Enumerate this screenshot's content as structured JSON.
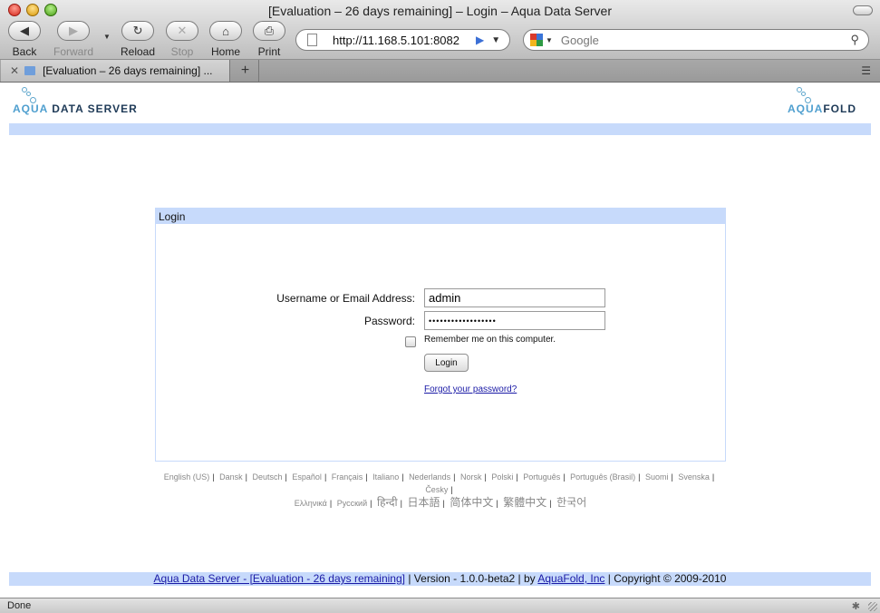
{
  "window": {
    "title": "[Evaluation – 26 days remaining] – Login – Aqua Data Server"
  },
  "toolbar": {
    "back": "Back",
    "forward": "Forward",
    "reload": "Reload",
    "stop": "Stop",
    "home": "Home",
    "print": "Print"
  },
  "address": {
    "url": "http://11.168.5.101:8082"
  },
  "search": {
    "placeholder": "Google"
  },
  "tabs": [
    {
      "title": "[Evaluation – 26 days remaining] ..."
    }
  ],
  "logos": {
    "left_aqua": "AQUA",
    "left_rest": "DATA SERVER",
    "right_aqua": "AQUA",
    "right_rest": "FOLD"
  },
  "login": {
    "header": "Login",
    "username_label": "Username or Email Address:",
    "username_value": "admin",
    "password_label": "Password:",
    "password_value": "••••••••••••••••••",
    "remember_label": "Remember me on this computer.",
    "button": "Login",
    "forgot": "Forgot your password?"
  },
  "languages": [
    "English (US)",
    "Dansk",
    "Deutsch",
    "Español",
    "Français",
    "Italiano",
    "Nederlands",
    "Norsk",
    "Polski",
    "Português",
    "Português (Brasil)",
    "Suomi",
    "Svenska",
    "Česky",
    "Ελληνικά",
    "Русский",
    "हिन्दी",
    "日本語",
    "简体中文",
    "繁體中文",
    "한국어"
  ],
  "footer": {
    "product_link": "Aqua Data Server - [Evaluation - 26 days remaining]",
    "version": "Version - 1.0.0-beta2",
    "by": "by",
    "company_link": "AquaFold, Inc",
    "copyright": "Copyright © 2009-2010"
  },
  "status": {
    "text": "Done"
  }
}
